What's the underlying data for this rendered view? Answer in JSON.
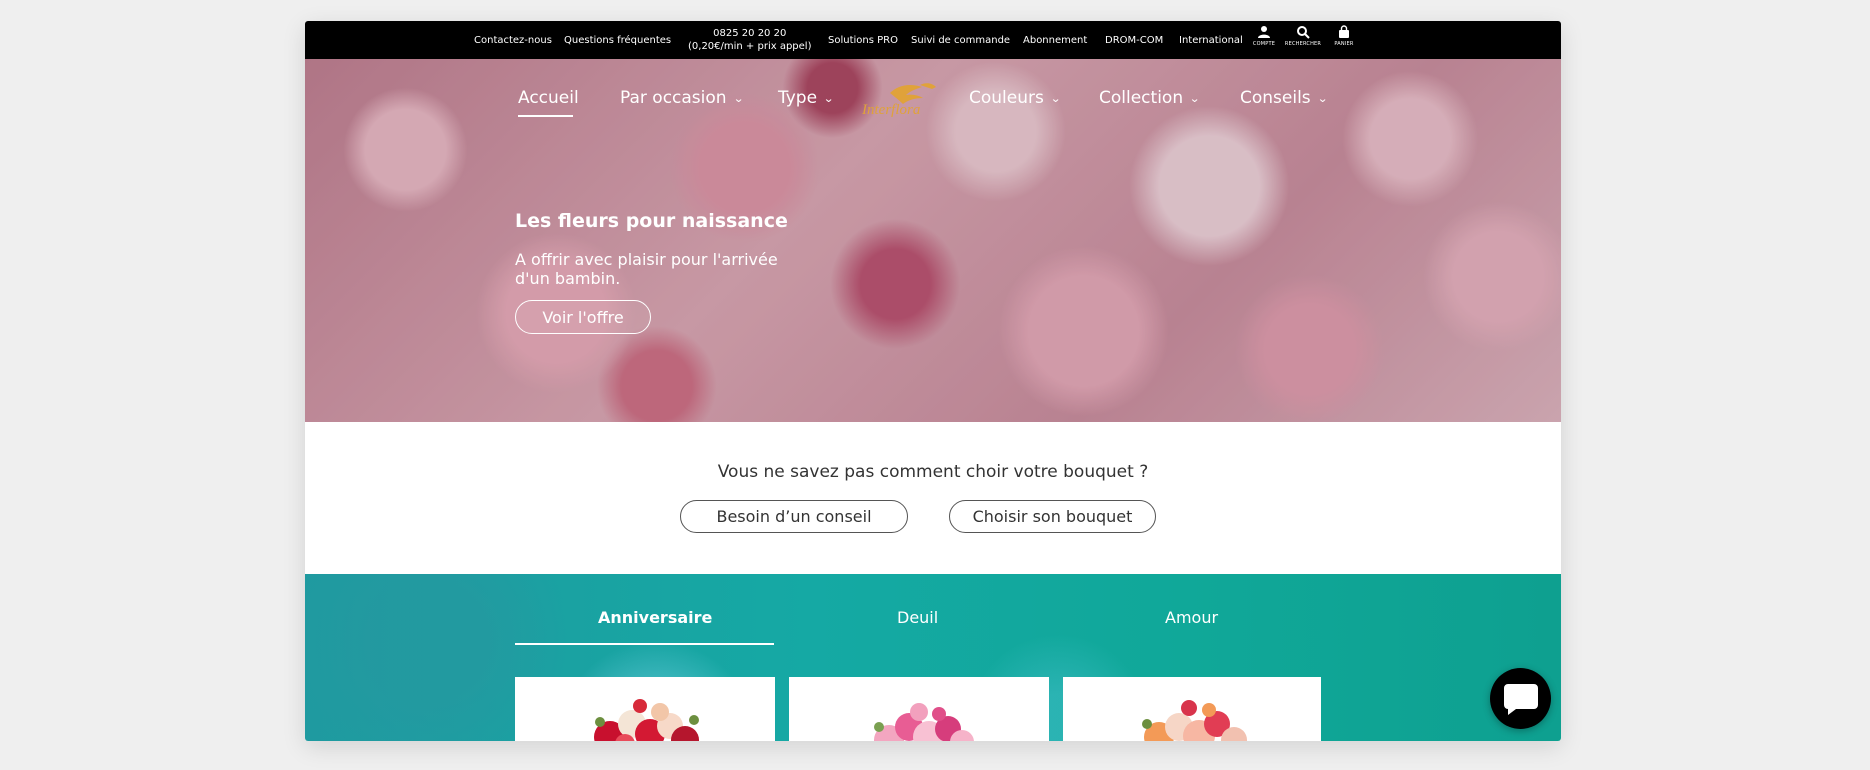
{
  "topbar": {
    "contact": "Contactez-nous",
    "faq": "Questions fréquentes",
    "phone_number": "0825 20 20 20",
    "phone_price": "(0,20€/min + prix appel)",
    "pro": "Solutions PRO",
    "tracking": "Suivi de commande",
    "subscription": "Abonnement",
    "dromcom": "DROM-COM",
    "international": "International",
    "account_label": "COMPTE",
    "search_label": "RECHERCHER",
    "cart_label": "PANIER"
  },
  "nav": {
    "home": "Accueil",
    "occasion": "Par occasion",
    "type": "Type",
    "logo": "Interflora",
    "colors": "Couleurs",
    "collection": "Collection",
    "advice": "Conseils"
  },
  "hero": {
    "title": "Les fleurs pour naissance",
    "subtitle": "A offrir avec plaisir pour l'arrivée d'un bambin.",
    "button": "Voir l'offre"
  },
  "help": {
    "question": "Vous ne savez pas comment choir votre bouquet ?",
    "advice_button": "Besoin d’un conseil",
    "choose_button": "Choisir son bouquet"
  },
  "tabs": {
    "birthday": "Anniversaire",
    "mourning": "Deuil",
    "love": "Amour"
  },
  "colors": {
    "teal": "#10a899",
    "topbar": "#000000",
    "logo_gold": "#e0a23a"
  }
}
